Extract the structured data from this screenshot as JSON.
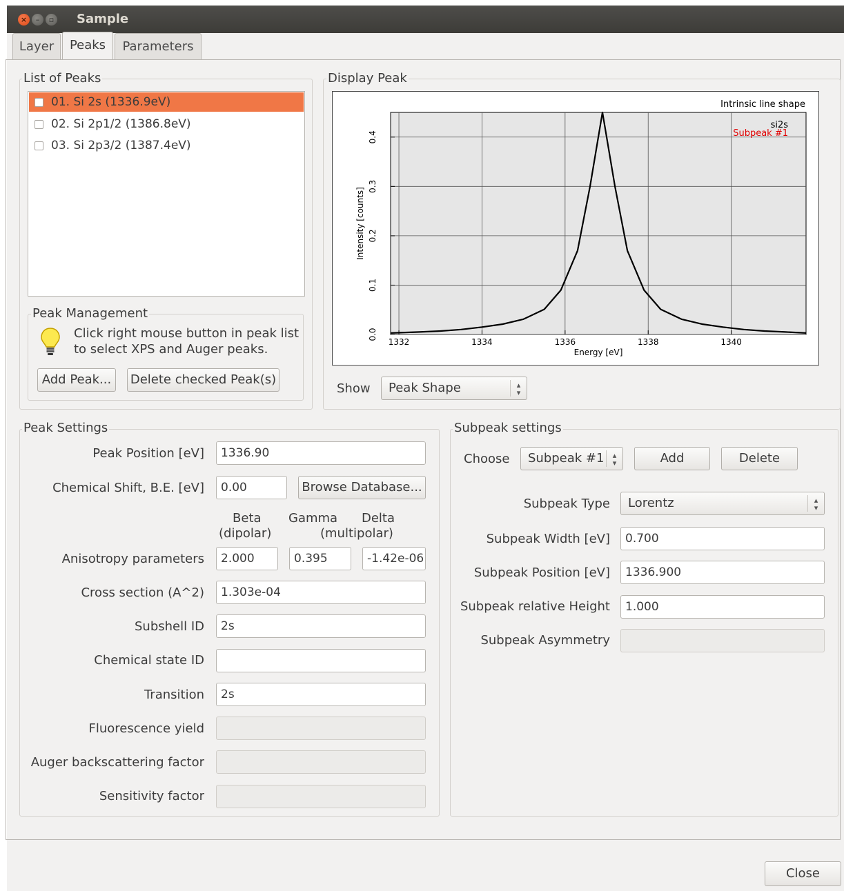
{
  "window": {
    "title": "Sample"
  },
  "tabs": [
    {
      "label": "Layer"
    },
    {
      "label": "Peaks"
    },
    {
      "label": "Parameters"
    }
  ],
  "peak_list": {
    "title": "List of Peaks",
    "items": [
      {
        "label": "01. Si 2s (1336.9eV)",
        "selected": true
      },
      {
        "label": "02. Si 2p1/2 (1386.8eV)",
        "selected": false
      },
      {
        "label": "03. Si 2p3/2 (1387.4eV)",
        "selected": false
      }
    ]
  },
  "peak_management": {
    "title": "Peak Management",
    "hint_line1": "Click right mouse button in peak list",
    "hint_line2": "to select XPS and Auger peaks.",
    "add_label": "Add Peak...",
    "delete_label": "Delete checked Peak(s)"
  },
  "display_peak": {
    "title": "Display Peak",
    "show_label": "Show",
    "show_value": "Peak Shape"
  },
  "chart_data": {
    "type": "line",
    "title": "Intrinsic line shape",
    "xlabel": "Energy [eV]",
    "ylabel": "Intensity [counts]",
    "xlim": [
      1331.8,
      1341.8
    ],
    "ylim": [
      0,
      0.45
    ],
    "x_ticks": [
      "1332",
      "1334",
      "1336",
      "1338",
      "1340"
    ],
    "y_ticks": [
      "0.0",
      "0.1",
      "0.2",
      "0.3",
      "0.4"
    ],
    "grid": true,
    "legend_position": "top-right",
    "legend": [
      {
        "text": "si2s",
        "color": "#000000"
      },
      {
        "text": "Subpeak #1",
        "color": "#e00000"
      }
    ],
    "series": [
      {
        "name": "si2s",
        "color": "#000000",
        "x": [
          1331.8,
          1332.5,
          1333.0,
          1333.5,
          1334.0,
          1334.5,
          1335.0,
          1335.5,
          1335.9,
          1336.3,
          1336.6,
          1336.9,
          1337.2,
          1337.5,
          1337.9,
          1338.3,
          1338.8,
          1339.3,
          1339.8,
          1340.3,
          1340.8,
          1341.3,
          1341.8
        ],
        "y": [
          0.003,
          0.005,
          0.007,
          0.01,
          0.015,
          0.021,
          0.031,
          0.051,
          0.09,
          0.17,
          0.3,
          0.45,
          0.3,
          0.17,
          0.09,
          0.051,
          0.031,
          0.021,
          0.015,
          0.01,
          0.007,
          0.005,
          0.003
        ]
      }
    ]
  },
  "peak_settings": {
    "title": "Peak Settings",
    "position_label": "Peak Position [eV]",
    "position_value": "1336.90",
    "shift_label": "Chemical Shift, B.E. [eV]",
    "shift_value": "0.00",
    "browse_label": "Browse Database...",
    "beta_line1": "Beta",
    "beta_line2": "(dipolar)",
    "gamma_label": "Gamma",
    "delta_label": "Delta",
    "multipolar_label": "(multipolar)",
    "aniso_label": "Anisotropy parameters",
    "beta_value": "2.000",
    "gamma_value": "0.395",
    "delta_value": "-1.42e-06",
    "cross_label": "Cross section (A^2)",
    "cross_value": "1.303e-04",
    "subshell_label": "Subshell ID",
    "subshell_value": "2s",
    "chemstate_label": "Chemical state ID",
    "chemstate_value": "",
    "transition_label": "Transition",
    "transition_value": "2s",
    "fluor_label": "Fluorescence yield",
    "auger_label": "Auger backscattering factor",
    "sens_label": "Sensitivity factor"
  },
  "subpeak_settings": {
    "title": "Subpeak settings",
    "choose_label": "Choose",
    "choose_value": "Subpeak #1",
    "add_label": "Add",
    "delete_label": "Delete",
    "type_label": "Subpeak Type",
    "type_value": "Lorentz",
    "width_label": "Subpeak Width [eV]",
    "width_value": "0.700",
    "position_label": "Subpeak Position [eV]",
    "position_value": "1336.900",
    "height_label": "Subpeak relative Height",
    "height_value": "1.000",
    "asym_label": "Subpeak Asymmetry"
  },
  "footer": {
    "close_label": "Close"
  }
}
